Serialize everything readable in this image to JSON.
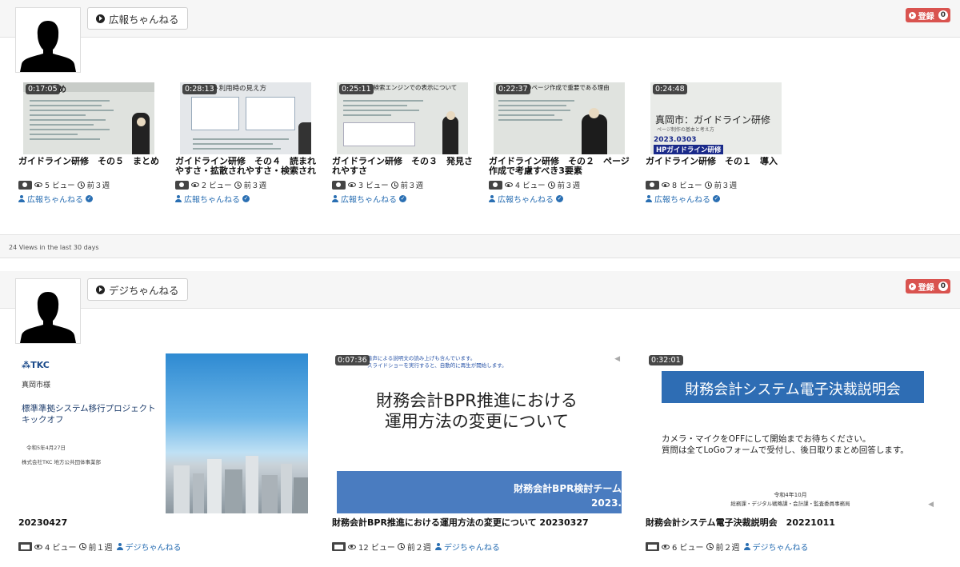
{
  "channels": [
    {
      "name": "広報ちゃんねる",
      "subscribe_label": "登録",
      "subscribe_count": "0",
      "footer": "24 Views in the last 30 days",
      "videos": [
        {
          "duration": "0:17:05",
          "title": "ガイドライン研修　その５　まとめ",
          "views": "5 ビュー",
          "ago": "前３週",
          "author": "広報ちゃんねる"
        },
        {
          "duration": "0:28:13",
          "title": "ガイドライン研修　その４　読まれやすさ・拡散されやすさ・検索されやすさ",
          "views": "2 ビュー",
          "ago": "前３週",
          "author": "広報ちゃんねる"
        },
        {
          "duration": "0:25:11",
          "title": "ガイドライン研修　その３　発見されやすさ",
          "views": "3 ビュー",
          "ago": "前３週",
          "author": "広報ちゃんねる"
        },
        {
          "duration": "0:22:37",
          "title": "ガイドライン研修　その２　ページ作成で考慮すべき3要素",
          "views": "4 ビュー",
          "ago": "前３週",
          "author": "広報ちゃんねる"
        },
        {
          "duration": "0:24:48",
          "title": "ガイドライン研修　その１　導入",
          "views": "8 ビュー",
          "ago": "前３週",
          "author": "広報ちゃんねる"
        }
      ]
    },
    {
      "name": "デジちゃんねる",
      "subscribe_label": "登録",
      "subscribe_count": "0",
      "videos": [
        {
          "duration": "",
          "title": "20230427",
          "views": "4 ビュー",
          "ago": "前１週",
          "author": "デジちゃんねる"
        },
        {
          "duration": "0:07:36",
          "title": "財務会計BPR推進における運用方法の変更について 20230327",
          "views": "12 ビュー",
          "ago": "前２週",
          "author": "デジちゃんねる"
        },
        {
          "duration": "0:32:01",
          "title": "財務会計システム電子決裁説明会　20221011",
          "views": "6 ビュー",
          "ago": "前２週",
          "author": "デジちゃんねる"
        }
      ]
    }
  ],
  "slides": {
    "s1_sub": "め",
    "s2_head": "ト利用時の見え方",
    "s3_head": "：検索エンジンでの表示について",
    "s4_head": "のページ作成で重要である理由",
    "s5_title": "真岡市：ガイドライン研修",
    "s5_sub": "ページ制作の基本と考え方",
    "s5_date": "2023.0303",
    "s5_tag": "HPガイドライン研修",
    "tkc_logo": "TKC",
    "tkc_client": "真岡市様",
    "tkc_title": "標準準拠システム移行プロジェクト\nキックオフ",
    "tkc_date": "令和5年4月27日",
    "tkc_org": "株式会社TKC  地方公共団体事業部",
    "bpr_note": "音声による説明文の読み上げも含んでいます。\nスライドショーを実行すると、自動的に再生が開始します。",
    "bpr_title": "財務会計BPR推進における\n運用方法の変更について",
    "bpr_banner": "財務会計BPR検討チーム",
    "bpr_year": "2023.",
    "ds_title": "財務会計システム電子決裁説明会",
    "ds_body": "カメラ・マイクをOFFにして開始までお待ちください。\n質問は全てLoGoフォームで受付し、後日取りまとめ回答します。",
    "ds_date": "令和4年10月",
    "ds_org": "総務課・デジタル戦略課・会計課・監査委員事務局"
  },
  "colors": {
    "subscribe": "#d9534f",
    "link": "#2a6fb3",
    "banner": "#2e6db4"
  }
}
